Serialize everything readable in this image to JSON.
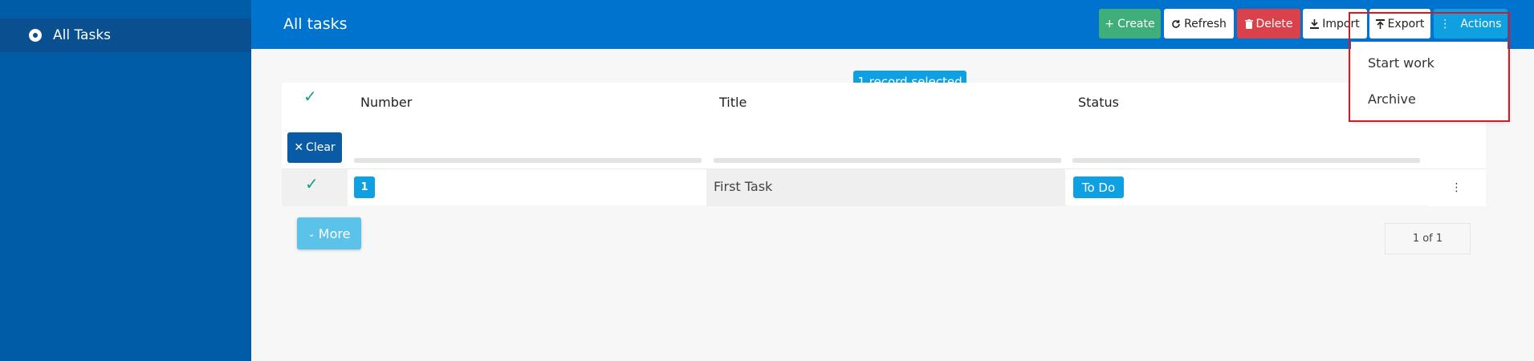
{
  "sidebar": {
    "items": [
      {
        "label": "All Tasks",
        "icon": "radio-dot-icon"
      }
    ]
  },
  "header": {
    "title": "All tasks"
  },
  "toolbar": {
    "create_label": "Create",
    "refresh_label": "Refresh",
    "delete_label": "Delete",
    "import_label": "Import",
    "export_label": "Export",
    "actions_label": "Actions"
  },
  "selection": {
    "badge": "1 record selected",
    "clear_label": "Clear"
  },
  "table": {
    "columns": [
      "Number",
      "Title",
      "Status"
    ],
    "rows": [
      {
        "number": "1",
        "title": "First Task",
        "status": "To Do"
      }
    ]
  },
  "more_label": "More",
  "pager": {
    "text": "1 of 1"
  },
  "actions_menu": {
    "items": [
      "Start work",
      "Archive"
    ]
  },
  "colors": {
    "sidebar": "#015ca8",
    "header": "#0073cf",
    "create": "#40ae7a",
    "delete": "#d9424b",
    "accent": "#0ea0e0",
    "highlight": "#e0161f"
  }
}
